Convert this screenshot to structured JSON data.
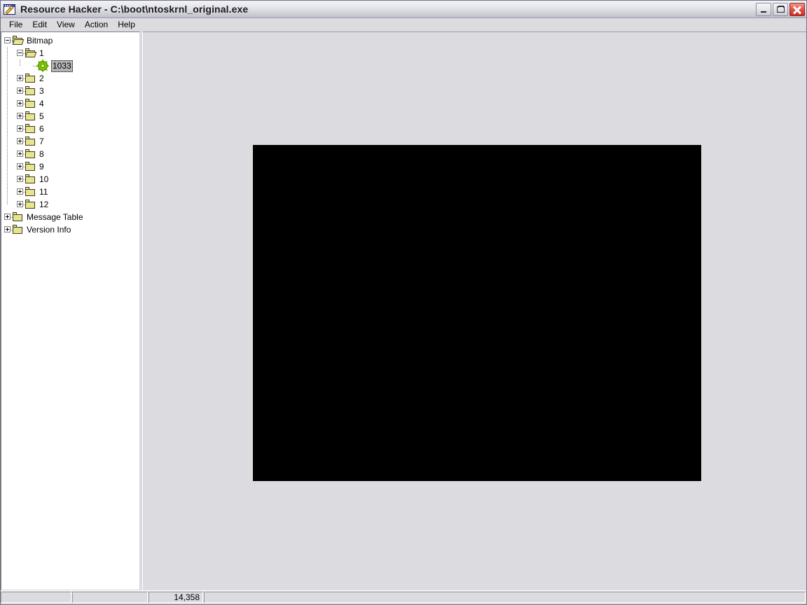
{
  "window": {
    "app_name": "Resource Hacker",
    "separator": "-",
    "file_path": "C:\\boot\\ntoskrnl_original.exe",
    "title": "Resource Hacker  -  C:\\boot\\ntoskrnl_original.exe",
    "app_icon": "resource-hacker-icon",
    "buttons": {
      "minimize": "minimize-icon",
      "restore": "restore-icon",
      "close": "close-icon"
    }
  },
  "menu": {
    "items": [
      {
        "label": "File"
      },
      {
        "label": "Edit"
      },
      {
        "label": "View"
      },
      {
        "label": "Action"
      },
      {
        "label": "Help"
      }
    ]
  },
  "tree": {
    "nodes": [
      {
        "label": "Bitmap",
        "depth": 0,
        "icon": "folder-open-icon",
        "expander": "minus",
        "selected": false
      },
      {
        "label": "1",
        "depth": 1,
        "icon": "folder-open-icon",
        "expander": "minus",
        "selected": false
      },
      {
        "label": "1033",
        "depth": 2,
        "icon": "gear-icon",
        "expander": "none",
        "selected": true
      },
      {
        "label": "2",
        "depth": 1,
        "icon": "folder-closed-icon",
        "expander": "plus",
        "selected": false
      },
      {
        "label": "3",
        "depth": 1,
        "icon": "folder-closed-icon",
        "expander": "plus",
        "selected": false
      },
      {
        "label": "4",
        "depth": 1,
        "icon": "folder-closed-icon",
        "expander": "plus",
        "selected": false
      },
      {
        "label": "5",
        "depth": 1,
        "icon": "folder-closed-icon",
        "expander": "plus",
        "selected": false
      },
      {
        "label": "6",
        "depth": 1,
        "icon": "folder-closed-icon",
        "expander": "plus",
        "selected": false
      },
      {
        "label": "7",
        "depth": 1,
        "icon": "folder-closed-icon",
        "expander": "plus",
        "selected": false
      },
      {
        "label": "8",
        "depth": 1,
        "icon": "folder-closed-icon",
        "expander": "plus",
        "selected": false
      },
      {
        "label": "9",
        "depth": 1,
        "icon": "folder-closed-icon",
        "expander": "plus",
        "selected": false
      },
      {
        "label": "10",
        "depth": 1,
        "icon": "folder-closed-icon",
        "expander": "plus",
        "selected": false
      },
      {
        "label": "11",
        "depth": 1,
        "icon": "folder-closed-icon",
        "expander": "plus",
        "selected": false
      },
      {
        "label": "12",
        "depth": 1,
        "icon": "folder-closed-icon",
        "expander": "plus",
        "selected": false
      },
      {
        "label": "Message Table",
        "depth": 0,
        "icon": "folder-closed-icon",
        "expander": "plus",
        "selected": false
      },
      {
        "label": "Version Info",
        "depth": 0,
        "icon": "folder-closed-icon",
        "expander": "plus",
        "selected": false
      }
    ]
  },
  "content": {
    "preview_type": "bitmap",
    "preview_color": "#000000",
    "preview_width": 640,
    "preview_height": 480
  },
  "status_bar": {
    "panel1": "",
    "panel2": "",
    "panel3": "14,358",
    "panel4": ""
  },
  "colors": {
    "window_background": "#dcdce0",
    "tree_background": "#ffffff",
    "selection": "#b4b4b4",
    "close_button": "#d63a2c",
    "folder": "#e8e48e",
    "gear": "#7ec800"
  }
}
